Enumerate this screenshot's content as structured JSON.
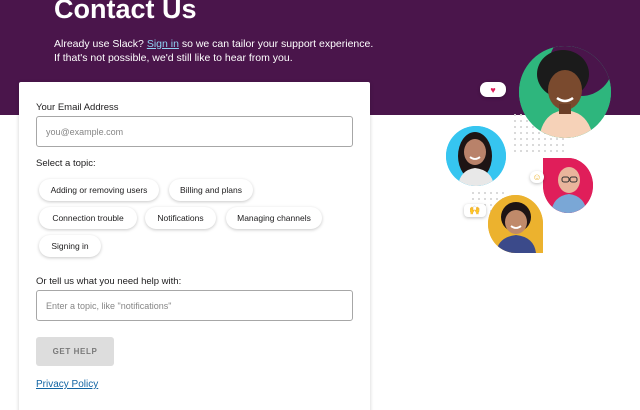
{
  "header": {
    "title": "Contact Us",
    "line1_pre": "Already use Slack? ",
    "signin_link": "Sign in",
    "line1_post": " so we can tailor your support experience.",
    "line2": "If that's not possible, we'd still like to hear from you."
  },
  "form": {
    "email_label": "Your Email Address",
    "email_placeholder": "you@example.com",
    "topic_label": "Select a topic:",
    "topics": [
      "Adding or removing users",
      "Billing and plans",
      "Connection trouble",
      "Notifications",
      "Managing channels",
      "Signing in"
    ],
    "help_label": "Or tell us what you need help with:",
    "help_placeholder": "Enter a topic, like \"notifications\"",
    "submit_label": "GET HELP",
    "privacy_link": "Privacy Policy"
  },
  "illustration": {
    "heart_icon": "heart-icon",
    "hands_icon": "raised-hands-icon",
    "smile_icon": "smile-emoji-icon",
    "colors": {
      "brand": "#4a154b",
      "green": "#2eb67d",
      "blue": "#36c5f0",
      "red": "#e01e5a",
      "yellow": "#ecb22e"
    }
  }
}
